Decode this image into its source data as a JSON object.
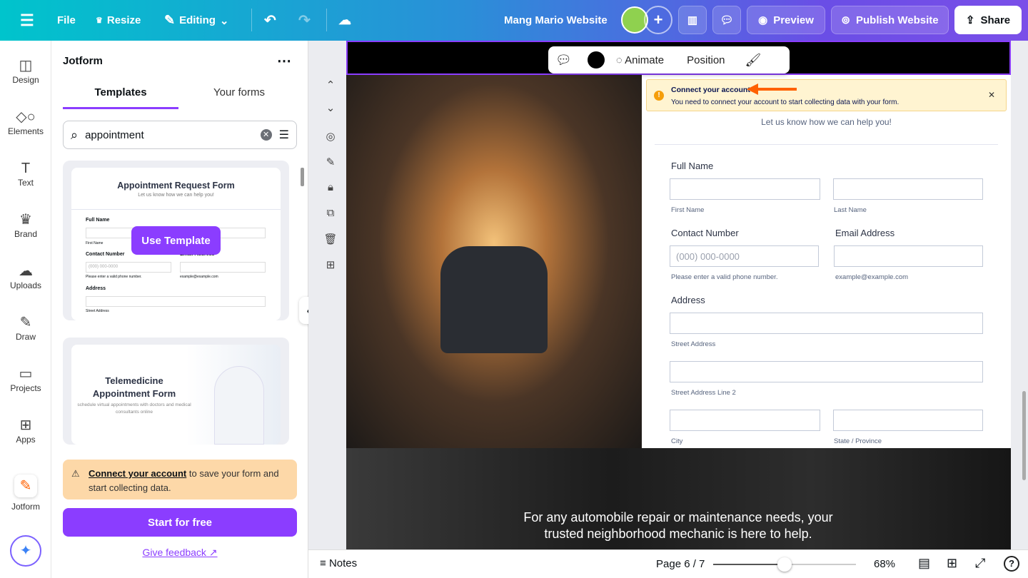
{
  "topbar": {
    "file": "File",
    "resize": "Resize",
    "editing": "Editing",
    "title": "Mang Mario Website",
    "preview": "Preview",
    "publish": "Publish Website",
    "share": "Share"
  },
  "rail": [
    {
      "label": "Design"
    },
    {
      "label": "Elements"
    },
    {
      "label": "Text"
    },
    {
      "label": "Brand"
    },
    {
      "label": "Uploads"
    },
    {
      "label": "Draw"
    },
    {
      "label": "Projects"
    },
    {
      "label": "Apps"
    },
    {
      "label": "Jotform"
    }
  ],
  "panel": {
    "title": "Jotform",
    "tabs": [
      "Templates",
      "Your forms"
    ],
    "search_value": "appointment",
    "templates": [
      {
        "title": "Appointment Request Form",
        "subtitle": "Let us know how we can help you!",
        "use_label": "Use Template",
        "fields": [
          "Full Name",
          "First Name",
          "Contact Number",
          "Email Address",
          "(000) 000-0000",
          "Please enter a valid phone number.",
          "example@example.com",
          "Address",
          "Street Address"
        ]
      },
      {
        "title": "Telemedicine Appointment Form",
        "subtitle": "schedule virtual appointments with doctors and medical consultants online"
      }
    ],
    "notice_link": "Connect your account",
    "notice_text": " to save your form and start collecting data.",
    "start": "Start for free",
    "feedback": "Give feedback"
  },
  "toolbar": {
    "animate": "Animate",
    "position": "Position"
  },
  "alert": {
    "title": "Connect your account",
    "text": "You need to connect your account to start collecting data with your form.",
    "accent": "#f59e0b"
  },
  "form": {
    "subtitle": "Let us know how we can help you!",
    "full_name": "Full Name",
    "first": "First Name",
    "last": "Last Name",
    "contact": "Contact Number",
    "phone_ph": "(000) 000-0000",
    "phone_hint": "Please enter a valid phone number.",
    "email": "Email Address",
    "email_hint": "example@example.com",
    "address": "Address",
    "street": "Street Address",
    "street2": "Street Address Line 2",
    "city": "City",
    "state": "State / Province"
  },
  "banner": {
    "text": "For any automobile repair or maintenance needs, your trusted neighborhood mechanic is here to help."
  },
  "bottom": {
    "notes": "Notes",
    "page": "Page 6 / 7",
    "zoom": "68%",
    "zoom_value": 68
  }
}
